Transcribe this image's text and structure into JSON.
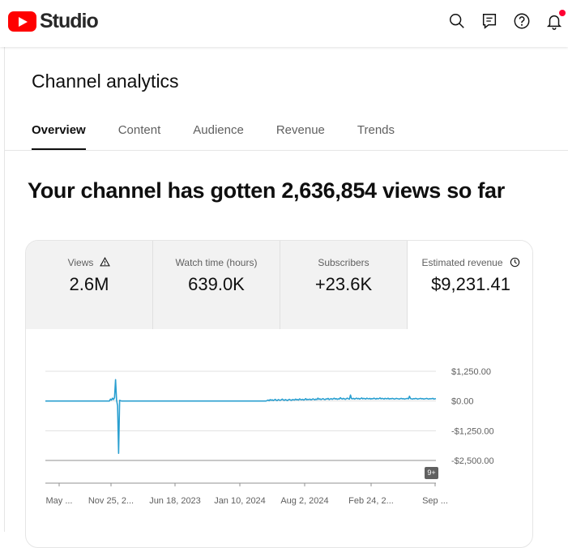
{
  "app": {
    "logo_text": "Studio",
    "brand_color": "#ff0000"
  },
  "topbar": {
    "icons": [
      "search-icon",
      "feedback-icon",
      "help-icon",
      "notifications-icon"
    ],
    "notification_dot_color": "#ff0033"
  },
  "page": {
    "title": "Channel analytics",
    "tabs": [
      {
        "label": "Overview",
        "active": true
      },
      {
        "label": "Content",
        "active": false
      },
      {
        "label": "Audience",
        "active": false
      },
      {
        "label": "Revenue",
        "active": false
      },
      {
        "label": "Trends",
        "active": false
      }
    ],
    "headline": "Your channel has gotten 2,636,854 views so far"
  },
  "metrics": [
    {
      "label": "Views",
      "value": "2.6M",
      "icon": "warning-icon",
      "selected": false
    },
    {
      "label": "Watch time (hours)",
      "value": "639.0K",
      "selected": false
    },
    {
      "label": "Subscribers",
      "value": "+23.6K",
      "selected": false
    },
    {
      "label": "Estimated revenue",
      "value": "$9,231.41",
      "icon": "clock-icon",
      "selected": true
    }
  ],
  "chart_data": {
    "type": "line",
    "series": [
      {
        "values": [
          0,
          0,
          0,
          0,
          0,
          0,
          0,
          0,
          0,
          0,
          0,
          0,
          0,
          0,
          0,
          0,
          0,
          0,
          0,
          0,
          0,
          0,
          0,
          0,
          0,
          0,
          0,
          0,
          0,
          0,
          0,
          0,
          0,
          0,
          0,
          0,
          0,
          0,
          0,
          0,
          0,
          0,
          0,
          0,
          0,
          0,
          0,
          0,
          0,
          0,
          0,
          0,
          0,
          0,
          0,
          0,
          0,
          0,
          0,
          0,
          0,
          0,
          0,
          0,
          80,
          40,
          120,
          60,
          140,
          900,
          40,
          -200,
          -2200,
          30,
          10,
          0,
          0,
          0,
          0,
          0,
          0,
          0,
          0,
          0,
          0,
          0,
          0,
          0,
          0,
          0,
          0,
          0,
          0,
          0,
          0,
          0,
          0,
          0,
          0,
          0,
          0,
          0,
          0,
          0,
          0,
          0,
          0,
          0,
          0,
          0,
          0,
          0,
          0,
          0,
          0,
          0,
          0,
          0,
          0,
          0,
          0,
          0,
          0,
          0,
          0,
          0,
          0,
          0,
          0,
          0,
          0,
          0,
          0,
          0,
          0,
          0,
          0,
          0,
          0,
          0,
          0,
          0,
          0,
          0,
          0,
          0,
          0,
          0,
          0,
          0,
          0,
          0,
          0,
          0,
          0,
          0,
          0,
          0,
          0,
          0,
          0,
          0,
          0,
          0,
          0,
          0,
          0,
          0,
          0,
          0,
          0,
          0,
          0,
          0,
          0,
          0,
          0,
          0,
          0,
          0,
          0,
          0,
          0,
          0,
          0,
          0,
          0,
          0,
          0,
          0,
          0,
          0,
          0,
          0,
          0,
          0,
          0,
          0,
          0,
          0,
          0,
          0,
          0,
          0,
          0,
          0,
          0,
          0,
          0,
          0,
          0,
          0,
          0,
          0,
          0,
          0,
          0,
          0,
          20,
          40,
          10,
          60,
          30,
          50,
          20,
          40,
          70,
          30,
          20,
          60,
          40,
          30,
          50,
          80,
          40,
          30,
          60,
          40,
          20,
          50,
          70,
          40,
          30,
          60,
          50,
          40,
          80,
          50,
          60,
          40,
          90,
          60,
          50,
          70,
          40,
          60,
          100,
          50,
          70,
          60,
          80,
          50,
          60,
          90,
          70,
          50,
          80,
          60,
          120,
          70,
          90,
          60,
          80,
          100,
          70,
          60,
          90,
          80,
          110,
          60,
          80,
          100,
          70,
          90,
          120,
          80,
          100,
          70,
          90,
          80,
          140,
          100,
          80,
          110,
          90,
          70,
          100,
          120,
          90,
          80,
          250,
          100,
          90,
          110,
          80,
          100,
          120,
          90,
          110,
          80,
          100,
          130,
          90,
          110,
          100,
          80,
          120,
          100,
          90,
          110,
          80,
          100,
          90,
          120,
          100,
          80,
          110,
          90,
          100,
          130,
          90,
          110,
          100,
          80,
          110,
          100,
          90,
          120,
          80,
          100,
          90,
          110,
          100,
          80,
          90,
          110,
          100,
          90,
          80,
          100,
          110,
          90,
          100,
          80,
          90,
          100,
          110,
          90,
          200,
          100,
          90,
          80,
          100,
          90,
          110,
          100,
          80,
          90,
          100,
          110,
          90,
          100,
          80,
          90,
          100,
          110,
          90,
          80,
          100,
          90,
          100,
          110,
          80,
          90,
          100
        ]
      }
    ],
    "y_ticks": [
      "$1,250.00",
      "$0.00",
      "-$1,250.00",
      "-$2,500.00"
    ],
    "y_tick_values": [
      1250,
      0,
      -1250,
      -2500
    ],
    "ylim": [
      -2500,
      1250
    ],
    "x_ticks": [
      "May ...",
      "Nov 25, 2...",
      "Jun 18, 2023",
      "Jan 10, 2024",
      "Aug 2, 2024",
      "Feb 24, 2...",
      "Sep ..."
    ],
    "line_color": "#2a9fd0",
    "grid": true,
    "badge": "9+"
  }
}
